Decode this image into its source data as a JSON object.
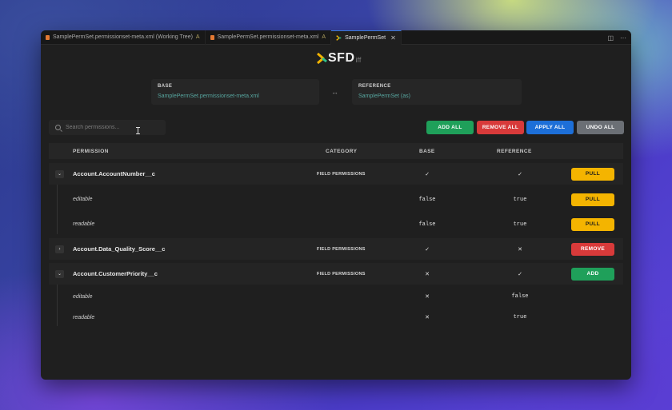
{
  "tabs": [
    {
      "label": "SamplePermSet.permissionset-meta.xml (Working Tree)",
      "status": "A",
      "active": false
    },
    {
      "label": "SamplePermSet.permissionset-meta.xml",
      "status": "A",
      "active": false
    },
    {
      "label": "SamplePermSet",
      "status": "",
      "active": true
    }
  ],
  "tab_actions": {
    "split": "◫",
    "more": "⋯"
  },
  "logo": {
    "main": "SFD",
    "suffix": "iff"
  },
  "base": {
    "label": "BASE",
    "value": "SamplePermSet.permissionset-meta.xml"
  },
  "reference": {
    "label": "REFERENCE",
    "value": "SamplePermSet (as)"
  },
  "swap_symbol": "↔",
  "search": {
    "placeholder": "Search permissions..."
  },
  "actions": {
    "add_all": "ADD ALL",
    "remove_all": "REMOVE ALL",
    "apply_all": "APPLY ALL",
    "undo_all": "UNDO ALL"
  },
  "columns": {
    "permission": "PERMISSION",
    "category": "CATEGORY",
    "base": "BASE",
    "reference": "REFERENCE"
  },
  "rows": [
    {
      "name": "Account.AccountNumber__c",
      "category": "FIELD PERMISSIONS",
      "base": "✓",
      "reference": "✓",
      "action": "PULL",
      "expanded": true,
      "children": [
        {
          "name": "editable",
          "base": "false",
          "reference": "true",
          "action": "PULL"
        },
        {
          "name": "readable",
          "base": "false",
          "reference": "true",
          "action": "PULL"
        }
      ]
    },
    {
      "name": "Account.Data_Quality_Score__c",
      "category": "FIELD PERMISSIONS",
      "base": "✓",
      "reference": "✕",
      "action": "REMOVE",
      "expanded": false
    },
    {
      "name": "Account.CustomerPriority__c",
      "category": "FIELD PERMISSIONS",
      "base": "✕",
      "reference": "✓",
      "action": "ADD",
      "expanded": true,
      "children": [
        {
          "name": "editable",
          "base": "✕",
          "reference": "false"
        },
        {
          "name": "readable",
          "base": "✕",
          "reference": "true"
        }
      ]
    }
  ],
  "colors": {
    "add": "#1fa05a",
    "remove": "#d83a3a",
    "apply": "#1d6fd8",
    "undo": "#6b6f75",
    "pull": "#f4b400"
  }
}
